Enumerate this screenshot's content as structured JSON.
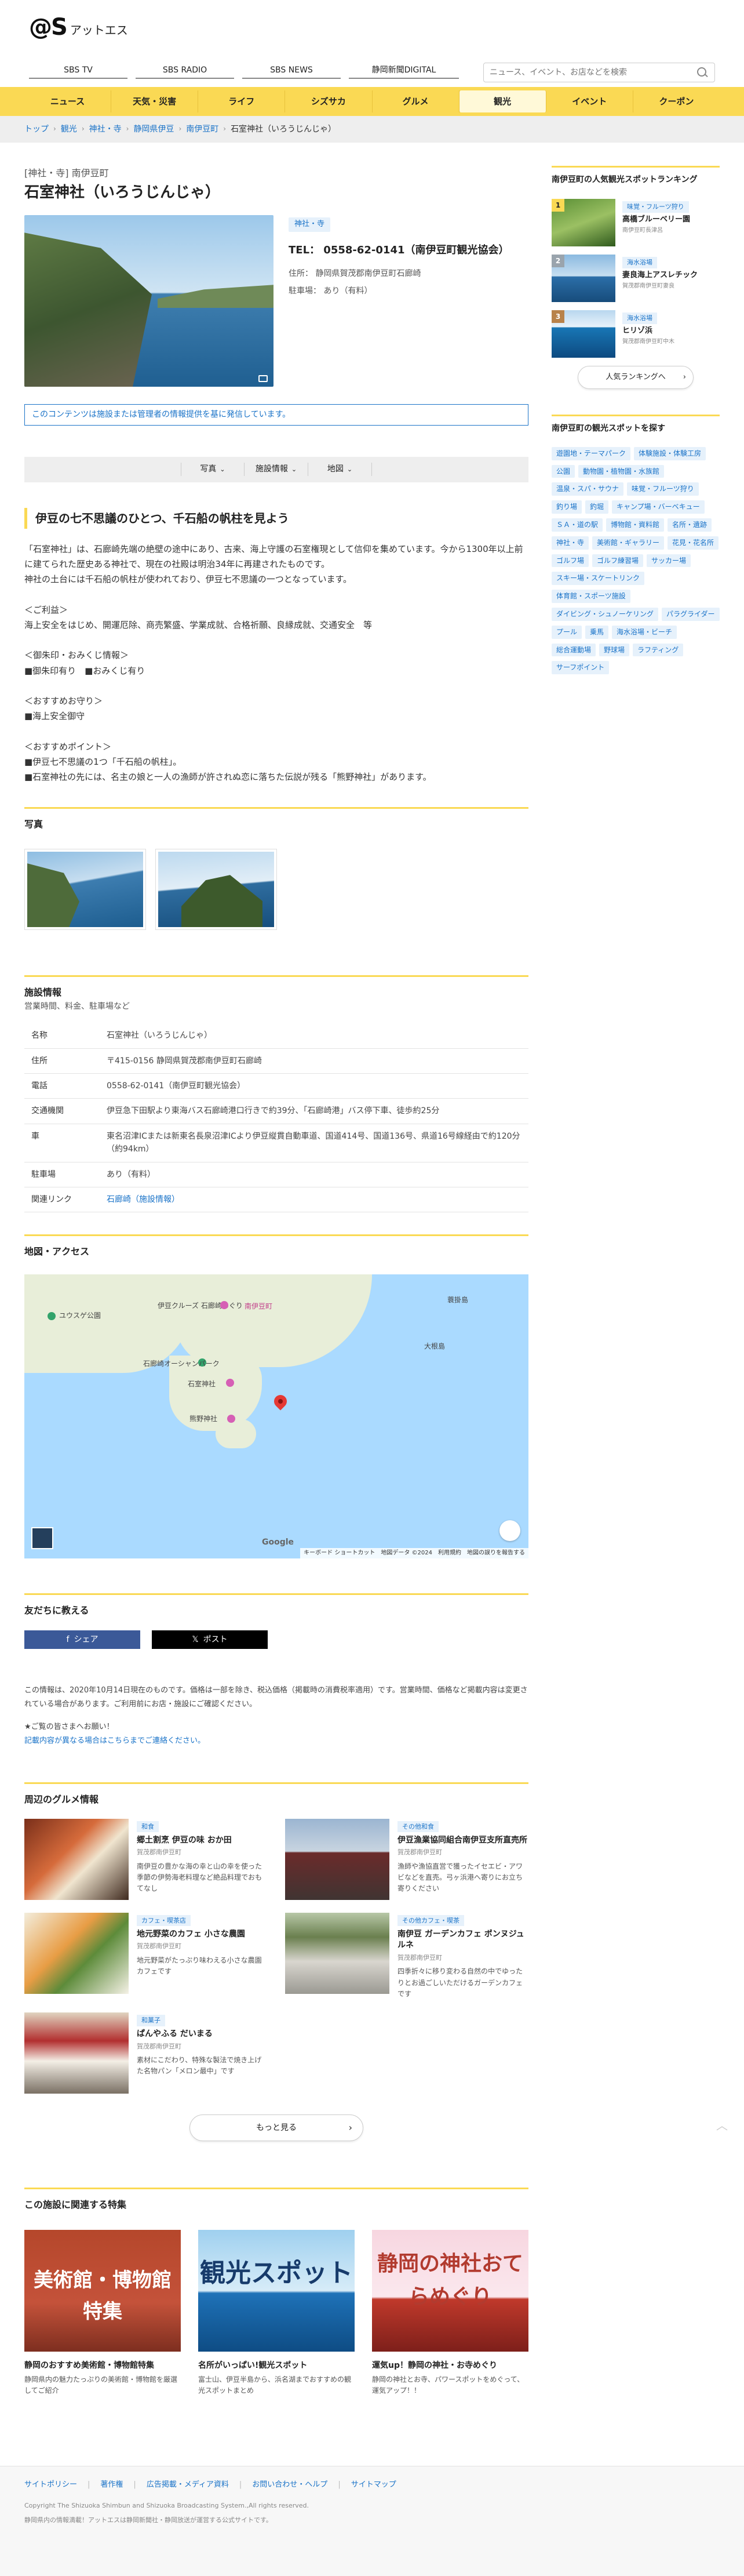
{
  "header": {
    "logo_mark": "@S",
    "logo_text": "アットエス",
    "media": [
      "SBS TV",
      "SBS RADIO",
      "SBS NEWS",
      "静岡新聞DIGITAL"
    ],
    "search_placeholder": "ニュース、イベント、お店などを検索"
  },
  "nav": [
    "ニュース",
    "天気・災害",
    "ライフ",
    "シズサカ",
    "グルメ",
    "観光",
    "イベント",
    "クーポン"
  ],
  "nav_active": "観光",
  "breadcrumb": [
    "トップ",
    "観光",
    "神社・寺",
    "静岡県伊豆",
    "南伊豆町",
    "石室神社（いろうじんじゃ）"
  ],
  "spot": {
    "category_line": "[神社・寺] 南伊豆町",
    "title": "石室神社（いろうじんじゃ）",
    "tag": "神社・寺",
    "tel": "TEL： 0558-62-0141（南伊豆町観光協会）",
    "address": "住所： 静岡県賀茂郡南伊豆町石廊崎",
    "parking": "駐車場： あり（有料）",
    "notice": "このコンテンツは施設または管理者の情報提供を基に発信しています。"
  },
  "tabs": [
    "写真",
    "施設情報",
    "地図"
  ],
  "intro": {
    "headline": "伊豆の七不思議のひとつ、千石船の帆柱を見よう",
    "body": "「石室神社」は、石廊崎先端の絶壁の途中にあり、古来、海上守護の石室権現として信仰を集めています。今から1300年以上前に建てられた歴史ある神社で、現在の社殿は明治34年に再建されたものです。\n神社の土台には千石船の帆柱が使われており、伊豆七不思議の一つとなっています。\n\n＜ご利益＞\n海上安全をはじめ、開運厄除、商売繁盛、学業成就、合格祈願、良縁成就、交通安全　等\n\n＜御朱印・おみくじ情報＞\n■御朱印有り　■おみくじ有り\n\n＜おすすめお守り＞\n■海上安全御守\n\n＜おすすめポイント＞\n■伊豆七不思議の1つ「千石船の帆柱」。\n■石室神社の先には、名主の娘と一人の漁師が許されぬ恋に落ちた伝説が残る「熊野神社」があります。"
  },
  "photos": {
    "title": "写真"
  },
  "facility": {
    "title": "施設情報",
    "subtitle": "営業時間、料金、駐車場など",
    "rows": [
      [
        "名称",
        "石室神社（いろうじんじゃ）"
      ],
      [
        "住所",
        "〒415-0156 静岡県賀茂郡南伊豆町石廊崎"
      ],
      [
        "電話",
        "0558-62-0141（南伊豆町観光協会）"
      ],
      [
        "交通機関",
        "伊豆急下田駅より東海バス石廊崎港口行きで約39分、「石廊崎港」バス停下車、徒歩約25分"
      ],
      [
        "車",
        "東名沼津ICまたは新東名長泉沼津ICより伊豆縦貫自動車道、国道414号、国道136号、県道16号線経由で約120分（約94km）"
      ],
      [
        "駐車場",
        "あり（有料）"
      ],
      [
        "関連リンク",
        "石廊崎（施設情報）"
      ]
    ]
  },
  "map": {
    "title": "地図・アクセス",
    "labels": [
      "ユウスゲ公園",
      "伊豆クルーズ 石廊崎めぐり",
      "南伊豆町",
      "石廊崎オーシャンパーク",
      "石室神社",
      "熊野神社",
      "蓑掛島",
      "大根島"
    ],
    "google": "Google",
    "footer": [
      "キーボード ショートカット",
      "地図データ ©2024",
      "利用規約",
      "地図の誤りを報告する"
    ]
  },
  "share": {
    "title": "友だちに教える",
    "facebook": "シェア",
    "x": "ポスト"
  },
  "note": {
    "text1": "この情報は、2020年10月14日現在のものです。価格は一部を除き、税込価格（掲載時の消費税率適用）です。営業時間、価格など掲載内容は変更されている場合があります。ご利用前にお店・施設にご確認ください。",
    "text2": "★ご覧の皆さまへお願い！",
    "link": "記載内容が異なる場合はこちらまでご連絡ください。"
  },
  "gourmet": {
    "title": "周辺のグルメ情報",
    "items": [
      {
        "tag": "和食",
        "name": "郷土割烹 伊豆の味 おか田",
        "area": "賀茂郡南伊豆町",
        "desc": "南伊豆の豊かな海の幸と山の幸を使った季節の伊勢海老料理など絶品料理でおもてなし"
      },
      {
        "tag": "その他和食",
        "name": "伊豆漁業協同組合南伊豆支所直売所",
        "area": "賀茂郡南伊豆町",
        "desc": "漁師や漁協直営で獲ったイセエビ・アワビなどを直売。弓ヶ浜港へ寄りにお立ち寄りください"
      },
      {
        "tag": "カフェ・喫茶店",
        "name": "地元野菜のカフェ 小さな農園",
        "area": "賀茂郡南伊豆町",
        "desc": "地元野菜がたっぷり味わえる小さな農園カフェです"
      },
      {
        "tag": "その他カフェ・喫茶",
        "name": "南伊豆 ガーデンカフェ ポンヌジュルネ",
        "area": "賀茂郡南伊豆町",
        "desc": "四季折々に移り変わる自然の中でゆったりとお過ごしいただけるガーデンカフェです"
      },
      {
        "tag": "和菓子",
        "name": "ぱんやふる だいまる",
        "area": "賀茂郡南伊豆町",
        "desc": "素材にこだわり、特殊な製法で焼き上げた名物パン「メロン最中」です"
      }
    ],
    "more": "もっと見る"
  },
  "features": {
    "title": "この施設に関連する特集",
    "items": [
      {
        "word": "美術館・博物館 特集",
        "title": "静岡のおすすめ美術館・博物館特集",
        "desc": "静岡県内の魅力たっぷりの美術館・博物館を厳選してご紹介"
      },
      {
        "word": "観光スポット",
        "title": "名所がいっぱい!観光スポット",
        "desc": "富士山、伊豆半島から、浜名湖までおすすめの観光スポットまとめ"
      },
      {
        "word": "静岡の神社おてらめぐり",
        "title": "運気up！静岡の神社・お寺めぐり",
        "desc": "静岡の神社とお寺、パワースポットをめぐって、運気アップ！！"
      }
    ]
  },
  "sidebar": {
    "ranking_title": "南伊豆町の人気観光スポットランキング",
    "ranking": [
      {
        "num": "1",
        "tag": "味覚・フルーツ狩り",
        "name": "高橋ブルーベリー園",
        "area": "南伊豆町長津呂"
      },
      {
        "num": "2",
        "tag": "海水浴場",
        "name": "妻良海上アスレチック",
        "area": "賀茂郡南伊豆町妻良"
      },
      {
        "num": "3",
        "tag": "海水浴場",
        "name": "ヒリゾ浜",
        "area": "賀茂郡南伊豆町中木"
      }
    ],
    "ranking_more": "人気ランキングへ",
    "genre_title": "南伊豆町の観光スポットを探す",
    "genres": [
      "遊園地・テーマパーク",
      "体験施設・体験工房",
      "公園",
      "動物園・植物園・水族館",
      "温泉・スパ・サウナ",
      "味覚・フルーツ狩り",
      "釣り場",
      "釣堀",
      "キャンプ場・バーベキュー",
      "ＳＡ・道の駅",
      "博物館・資料館",
      "名所・遺跡",
      "神社・寺",
      "美術館・ギャラリー",
      "花見・花名所",
      "ゴルフ場",
      "ゴルフ練習場",
      "サッカー場",
      "スキー場・スケートリンク",
      "体育館・スポーツ施設",
      "ダイビング・シュノーケリング",
      "パラグライダー",
      "プール",
      "乗馬",
      "海水浴場・ビーチ",
      "総合運動場",
      "野球場",
      "ラフティング",
      "サーフポイント"
    ]
  },
  "footer": {
    "links": [
      "サイトポリシー",
      "著作権",
      "広告掲載・メディア資料",
      "お問い合わせ・ヘルプ",
      "サイトマップ"
    ],
    "copyright": "Copyright The Shizuoka Shimbun and Shizuoka Broadcasting System.,All rights reserved.",
    "note": "静岡県内の情報満載！アットエスは静岡新聞社・静岡放送が運営する公式サイトです。"
  }
}
